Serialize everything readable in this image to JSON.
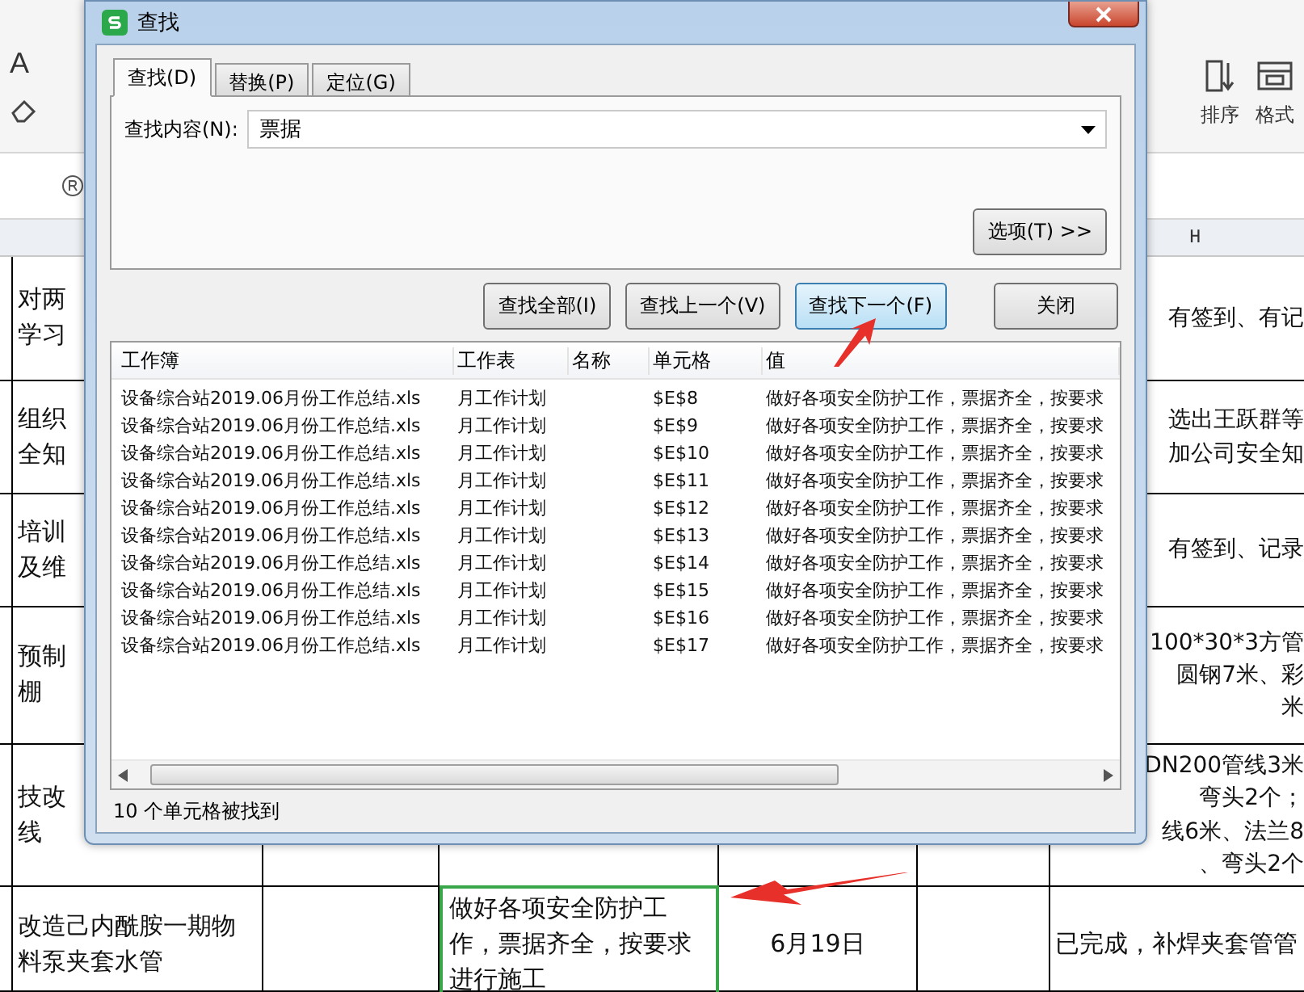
{
  "ribbon": {
    "font_button": "A",
    "buttons": [
      {
        "label": "排序"
      },
      {
        "label": "格式"
      }
    ]
  },
  "column_header": "H",
  "sheet_rows": [
    {
      "a": [
        "对两",
        "学习"
      ],
      "h": [
        "有签到、有记"
      ]
    },
    {
      "a": [
        "组织",
        "全知"
      ],
      "h": [
        "选出王跃群等",
        "加公司安全知"
      ]
    },
    {
      "a": [
        "培训",
        "及维"
      ],
      "h": [
        "有签到、记录"
      ]
    },
    {
      "a": [
        "预制",
        "棚"
      ],
      "h": [
        "100*30*3方管",
        "圆钢7米、彩",
        "米"
      ]
    },
    {
      "a": [
        "技改",
        "线"
      ],
      "h": [
        "DN200管线3米",
        "弯头2个；",
        "线6米、法兰8",
        "、弯头2个"
      ]
    },
    {
      "a": [
        "改造己内酰胺一期物",
        "料泵夹套水管"
      ],
      "e": "做好各项安全防护工作，票据齐全，按要求进行施工",
      "f": "6月19日",
      "h": [
        "已完成，补焊夹套管管"
      ],
      "selected": true
    }
  ],
  "dialog": {
    "title": "查找",
    "tabs": [
      {
        "label": "查找(D)",
        "selected": true
      },
      {
        "label": "替换(P)",
        "selected": false
      },
      {
        "label": "定位(G)",
        "selected": false
      }
    ],
    "find_label": "查找内容(N):",
    "find_value": "票据",
    "options_button": "选项(T) >>",
    "buttons": [
      {
        "label": "查找全部(I)",
        "selected": false
      },
      {
        "label": "查找上一个(V)",
        "selected": false
      },
      {
        "label": "查找下一个(F)",
        "selected": true
      },
      {
        "label": "关闭",
        "selected": false
      }
    ],
    "columns": [
      "工作簿",
      "工作表",
      "名称",
      "单元格",
      "值"
    ],
    "rows": [
      [
        "设备综合站2019.06月份工作总结.xls",
        "月工作计划",
        "",
        "$E$8",
        "做好各项安全防护工作，票据齐全，按要求"
      ],
      [
        "设备综合站2019.06月份工作总结.xls",
        "月工作计划",
        "",
        "$E$9",
        "做好各项安全防护工作，票据齐全，按要求"
      ],
      [
        "设备综合站2019.06月份工作总结.xls",
        "月工作计划",
        "",
        "$E$10",
        "做好各项安全防护工作，票据齐全，按要求"
      ],
      [
        "设备综合站2019.06月份工作总结.xls",
        "月工作计划",
        "",
        "$E$11",
        "做好各项安全防护工作，票据齐全，按要求"
      ],
      [
        "设备综合站2019.06月份工作总结.xls",
        "月工作计划",
        "",
        "$E$12",
        "做好各项安全防护工作，票据齐全，按要求"
      ],
      [
        "设备综合站2019.06月份工作总结.xls",
        "月工作计划",
        "",
        "$E$13",
        "做好各项安全防护工作，票据齐全，按要求"
      ],
      [
        "设备综合站2019.06月份工作总结.xls",
        "月工作计划",
        "",
        "$E$14",
        "做好各项安全防护工作，票据齐全，按要求"
      ],
      [
        "设备综合站2019.06月份工作总结.xls",
        "月工作计划",
        "",
        "$E$15",
        "做好各项安全防护工作，票据齐全，按要求"
      ],
      [
        "设备综合站2019.06月份工作总结.xls",
        "月工作计划",
        "",
        "$E$16",
        "做好各项安全防护工作，票据齐全，按要求"
      ],
      [
        "设备综合站2019.06月份工作总结.xls",
        "月工作计划",
        "",
        "$E$17",
        "做好各项安全防护工作，票据齐全，按要求"
      ]
    ],
    "status": "10 个单元格被找到"
  }
}
